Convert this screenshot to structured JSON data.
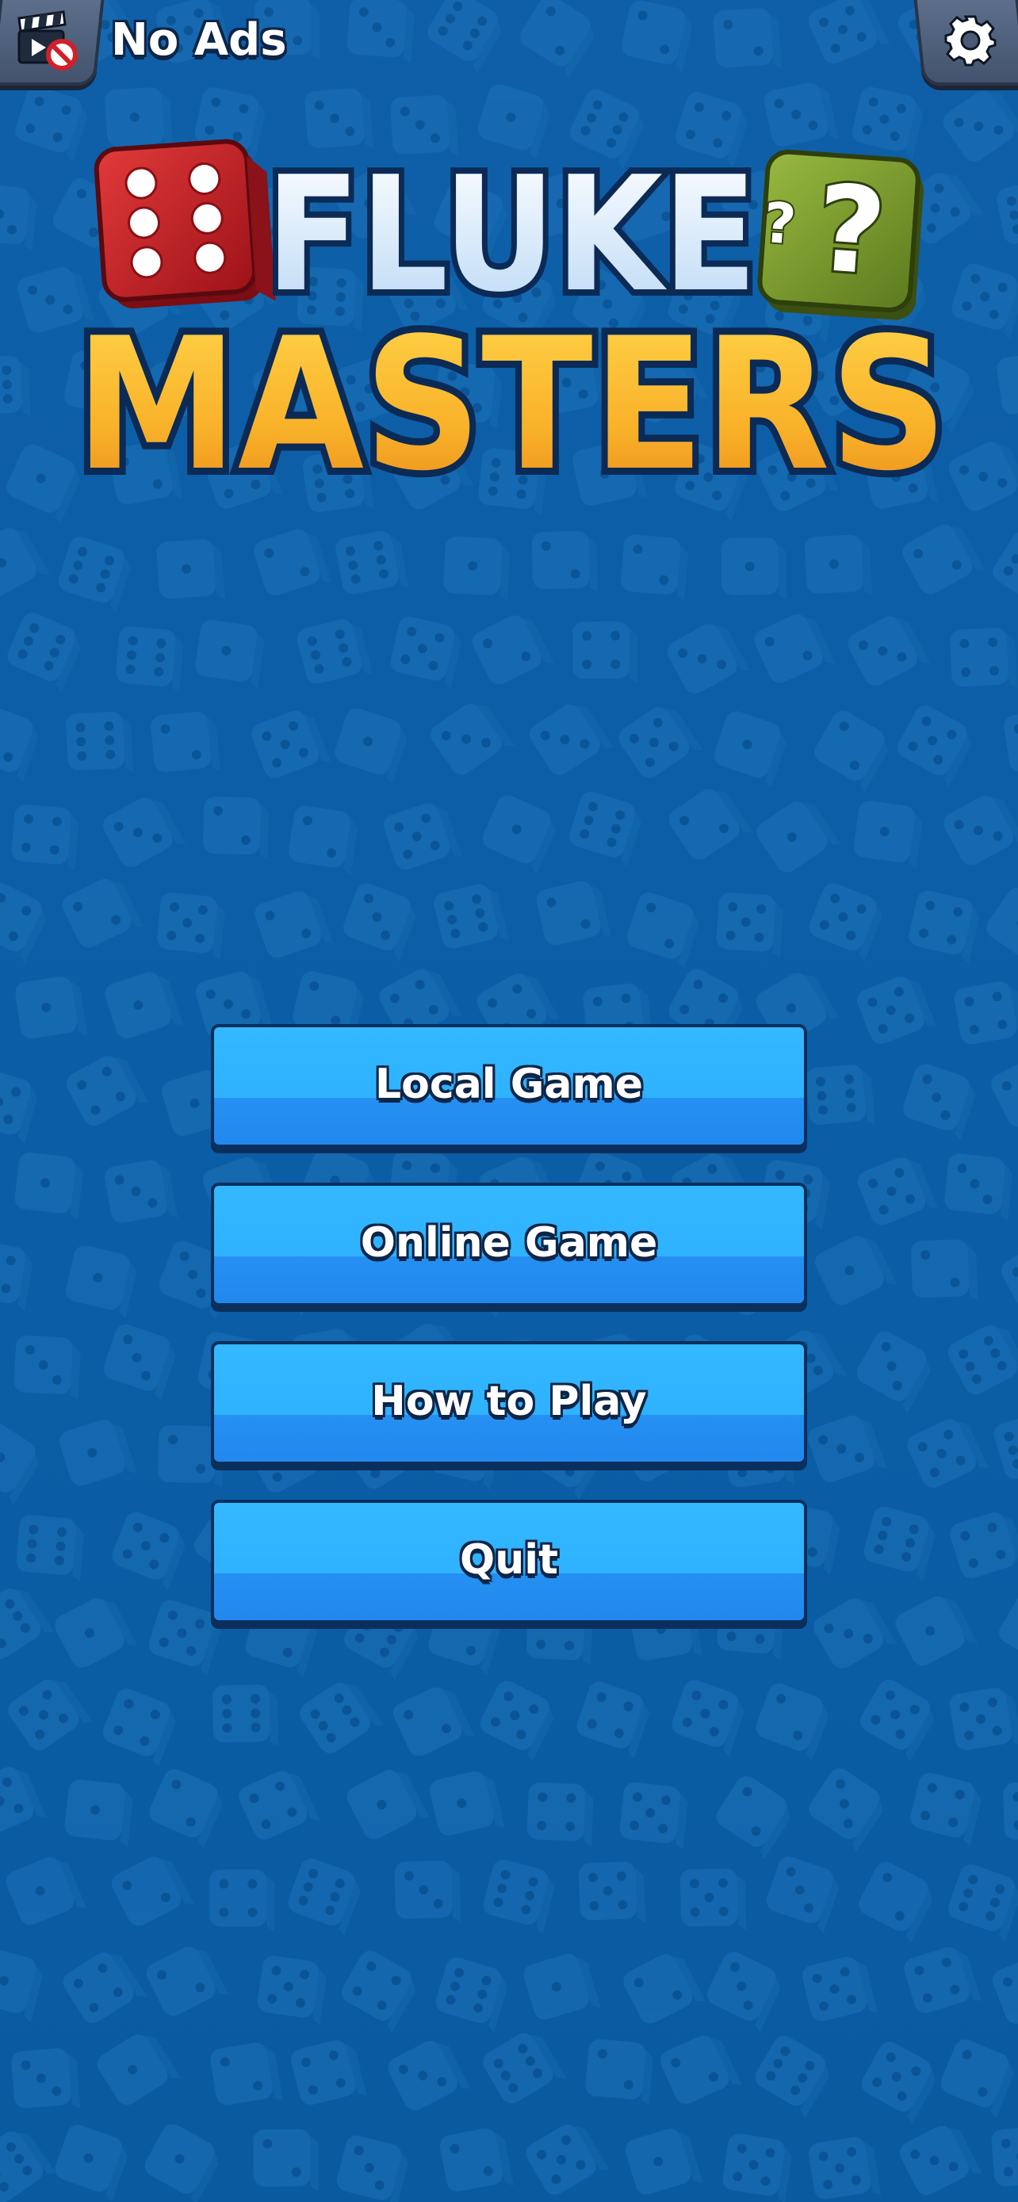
{
  "top_bar": {
    "no_ads_label": "No Ads",
    "no_ads_icon": "clapperboard-no-ads-icon",
    "settings_icon": "gear-icon"
  },
  "logo": {
    "line1": "FLUKE",
    "line2": "MASTERS",
    "left_die_icon": "red-die-six-icon",
    "right_die_icon": "green-question-die-icon"
  },
  "menu": {
    "local_game": "Local Game",
    "online_game": "Online Game",
    "how_to_play": "How to Play",
    "quit": "Quit"
  },
  "colors": {
    "background": "#0c5ea6",
    "button": "#2fb2ff",
    "button_outline": "#0b2f5c",
    "logo_yellow": "#f7b52a",
    "logo_white": "#e8f2ff",
    "die_red": "#c8232a",
    "die_green": "#7a9a2c"
  }
}
